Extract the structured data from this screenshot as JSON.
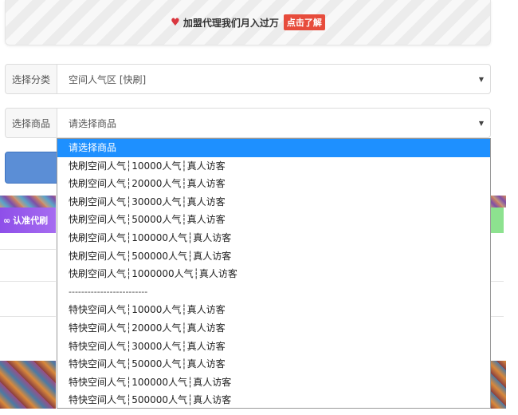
{
  "banner": {
    "heart_icon": "heart-icon",
    "text": "加盟代理我们月入过万",
    "cta": "点击了解",
    "colors": {
      "heart": "#d9363e",
      "badge": "#e74c3c"
    }
  },
  "category": {
    "label": "选择分类",
    "value": "空间人气区 [快刷]"
  },
  "goods": {
    "label": "选择商品",
    "value": "请选择商品"
  },
  "notice": {
    "icon": "link-icon",
    "text": "认准代刷"
  },
  "dropdown": {
    "options": [
      "请选择商品",
      "快刷空间人气┆10000人气┆真人访客",
      "快刷空间人气┆20000人气┆真人访客",
      "快刷空间人气┆30000人气┆真人访客",
      "快刷空间人气┆50000人气┆真人访客",
      "快刷空间人气┆100000人气┆真人访客",
      "快刷空间人气┆500000人气┆真人访客",
      "快刷空间人气┆1000000人气┆真人访客",
      "-------------------------",
      "特快空间人气┆10000人气┆真人访客",
      "特快空间人气┆20000人气┆真人访客",
      "特快空间人气┆30000人气┆真人访客",
      "特快空间人气┆50000人气┆真人访客",
      "特快空间人气┆100000人气┆真人访客",
      "特快空间人气┆500000人气┆真人访客"
    ],
    "selected_color": "#1e90ff"
  }
}
